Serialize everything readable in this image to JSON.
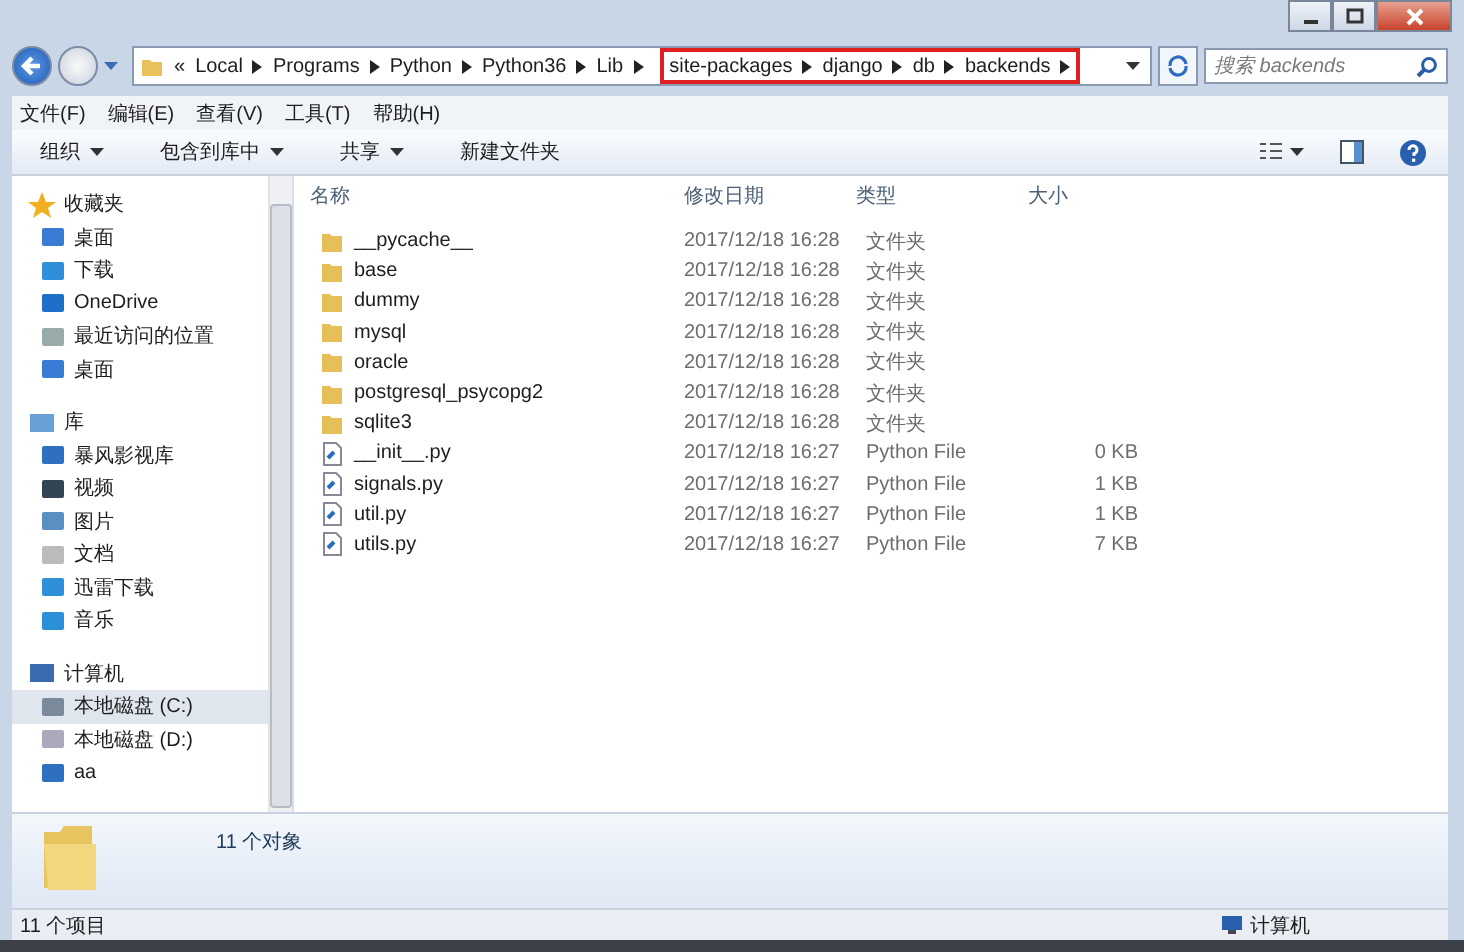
{
  "address_bar": {
    "segments": [
      {
        "label": "Local"
      },
      {
        "label": "Programs"
      },
      {
        "label": "Python"
      },
      {
        "label": "Python36"
      },
      {
        "label": "Lib"
      }
    ],
    "highlighted_segments": [
      {
        "label": "site-packages"
      },
      {
        "label": "django"
      },
      {
        "label": "db"
      },
      {
        "label": "backends"
      }
    ],
    "overflow": "«"
  },
  "search": {
    "placeholder": "搜索 backends"
  },
  "menu": [
    "文件(F)",
    "编辑(E)",
    "查看(V)",
    "工具(T)",
    "帮助(H)"
  ],
  "toolbar": [
    {
      "label": "组织",
      "dropdown": true
    },
    {
      "label": "包含到库中",
      "dropdown": true
    },
    {
      "label": "共享",
      "dropdown": true
    },
    {
      "label": "新建文件夹",
      "dropdown": false
    }
  ],
  "sidebar": {
    "groups": [
      {
        "label": "收藏夹",
        "kind": "star",
        "items": [
          {
            "label": "桌面",
            "kind": "desktop",
            "selected": false
          },
          {
            "label": "下载",
            "kind": "download",
            "selected": false
          },
          {
            "label": "OneDrive",
            "kind": "cloud",
            "selected": false
          },
          {
            "label": "最近访问的位置",
            "kind": "recent",
            "selected": false
          },
          {
            "label": "桌面",
            "kind": "desktop",
            "selected": false
          }
        ]
      },
      {
        "label": "库",
        "kind": "library",
        "items": [
          {
            "label": "暴风影视库",
            "kind": "media",
            "selected": false
          },
          {
            "label": "视频",
            "kind": "video",
            "selected": false
          },
          {
            "label": "图片",
            "kind": "image",
            "selected": false
          },
          {
            "label": "文档",
            "kind": "document",
            "selected": false
          },
          {
            "label": "迅雷下载",
            "kind": "download",
            "selected": false
          },
          {
            "label": "音乐",
            "kind": "music",
            "selected": false
          }
        ]
      },
      {
        "label": "计算机",
        "kind": "computer",
        "items": [
          {
            "label": "本地磁盘 (C:)",
            "kind": "system-drive",
            "selected": true
          },
          {
            "label": "本地磁盘 (D:)",
            "kind": "drive",
            "selected": false
          },
          {
            "label": "aa",
            "kind": "media",
            "selected": false
          }
        ]
      }
    ]
  },
  "table": {
    "columns": [
      "名称",
      "修改日期",
      "类型",
      "大小"
    ],
    "rows": [
      {
        "kind": "folder",
        "name": "__pycache__",
        "date": "2017/12/18 16:28",
        "type": "文件夹"
      },
      {
        "kind": "folder",
        "name": "base",
        "date": "2017/12/18 16:28",
        "type": "文件夹"
      },
      {
        "kind": "folder",
        "name": "dummy",
        "date": "2017/12/18 16:28",
        "type": "文件夹"
      },
      {
        "kind": "folder",
        "name": "mysql",
        "date": "2017/12/18 16:28",
        "type": "文件夹"
      },
      {
        "kind": "folder",
        "name": "oracle",
        "date": "2017/12/18 16:28",
        "type": "文件夹"
      },
      {
        "kind": "folder",
        "name": "postgresql_psycopg2",
        "date": "2017/12/18 16:28",
        "type": "文件夹"
      },
      {
        "kind": "folder",
        "name": "sqlite3",
        "date": "2017/12/18 16:28",
        "type": "文件夹"
      },
      {
        "kind": "file",
        "name": "__init__.py",
        "date": "2017/12/18 16:27",
        "type": "Python File",
        "size": "0 KB"
      },
      {
        "kind": "file",
        "name": "signals.py",
        "date": "2017/12/18 16:27",
        "type": "Python File",
        "size": "1 KB"
      },
      {
        "kind": "file",
        "name": "util.py",
        "date": "2017/12/18 16:27",
        "type": "Python File",
        "size": "1 KB"
      },
      {
        "kind": "file",
        "name": "utils.py",
        "date": "2017/12/18 16:27",
        "type": "Python File",
        "size": "7 KB"
      }
    ]
  },
  "details_pane": {
    "summary": "11 个对象"
  },
  "status_bar": {
    "count": "11 个项目",
    "location": "计算机"
  }
}
